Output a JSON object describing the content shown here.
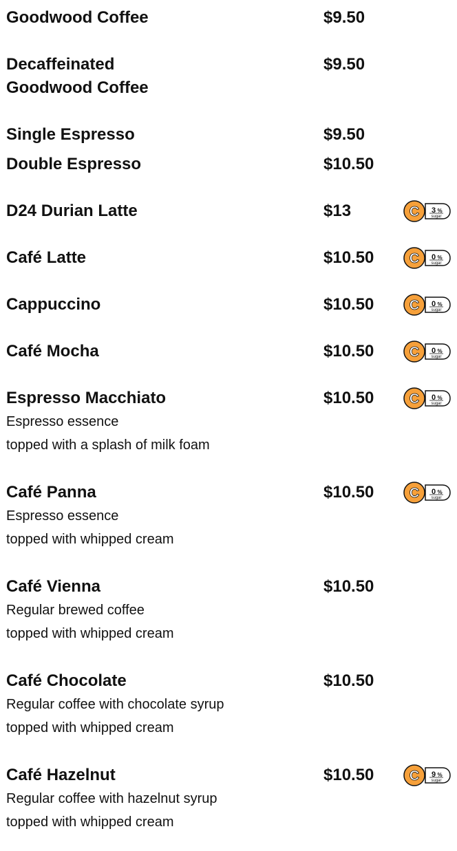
{
  "colors": {
    "badge_orange": "#F6A03A",
    "badge_dark": "#111111",
    "text": "#111111"
  },
  "menu": [
    {
      "name": "Goodwood Coffee",
      "price": "$9.50"
    },
    {
      "name": "Decaffeinated",
      "name2": "Goodwood Coffee",
      "price": "$9.50"
    },
    {
      "name": "Single Espresso",
      "price": "$9.50"
    },
    {
      "name": "Double Espresso",
      "price": "$10.50"
    },
    {
      "name": "D24 Durian Latte",
      "price": "$13",
      "badge": {
        "letter": "C",
        "sugar_value": "3",
        "sugar_unit": "%",
        "sugar_word": "sugar"
      }
    },
    {
      "name": "Café Latte",
      "price": "$10.50",
      "badge": {
        "letter": "C",
        "sugar_value": "0",
        "sugar_unit": "%",
        "sugar_word": "sugar"
      }
    },
    {
      "name": "Cappuccino",
      "price": "$10.50",
      "badge": {
        "letter": "C",
        "sugar_value": "0",
        "sugar_unit": "%",
        "sugar_word": "sugar"
      }
    },
    {
      "name": "Café Mocha",
      "price": "$10.50",
      "badge": {
        "letter": "C",
        "sugar_value": "0",
        "sugar_unit": "%",
        "sugar_word": "sugar"
      }
    },
    {
      "name": "Espresso Macchiato",
      "price": "$10.50",
      "desc1": "Espresso essence",
      "desc2": "topped with a splash of milk foam",
      "badge": {
        "letter": "C",
        "sugar_value": "0",
        "sugar_unit": "%",
        "sugar_word": "sugar"
      }
    },
    {
      "name": "Café Panna",
      "price": "$10.50",
      "desc1": "Espresso essence",
      "desc2": "topped with whipped cream",
      "badge": {
        "letter": "C",
        "sugar_value": "0",
        "sugar_unit": "%",
        "sugar_word": "sugar"
      }
    },
    {
      "name": "Café Vienna",
      "price": "$10.50",
      "desc1": "Regular brewed coffee",
      "desc2": "topped with whipped cream"
    },
    {
      "name": "Café Chocolate",
      "price": "$10.50",
      "desc1": "Regular coffee with chocolate syrup",
      "desc2": "topped with whipped cream"
    },
    {
      "name": "Café Hazelnut",
      "price": "$10.50",
      "desc1": "Regular coffee with hazelnut syrup",
      "desc2": "topped with whipped cream",
      "badge": {
        "letter": "C",
        "sugar_value": "9",
        "sugar_unit": "%",
        "sugar_word": "sugar"
      }
    }
  ]
}
